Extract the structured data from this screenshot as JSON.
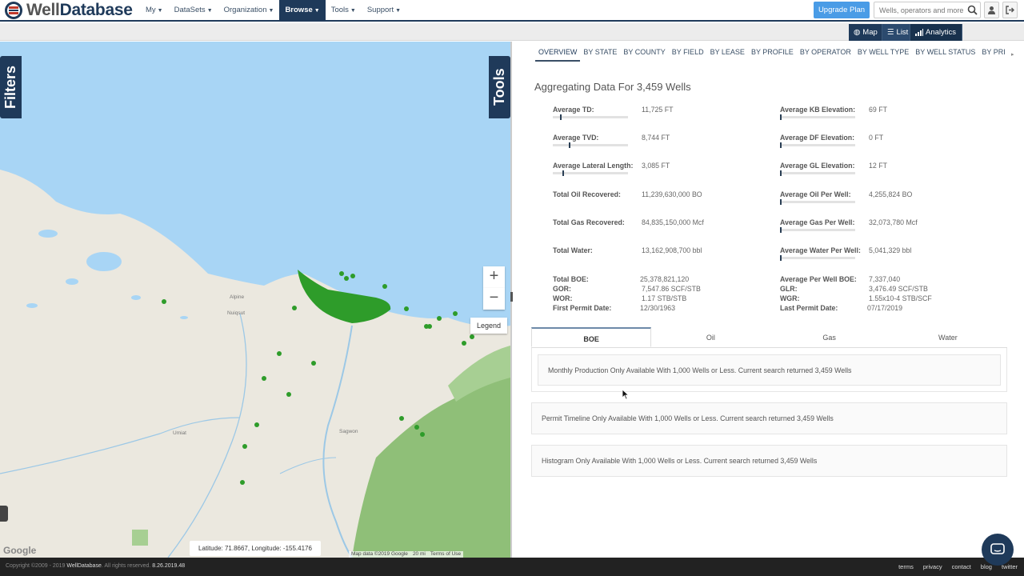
{
  "brand": {
    "logo_text_1": "Well",
    "logo_text_2": "Database"
  },
  "nav": {
    "items": [
      "My",
      "DataSets",
      "Organization",
      "Browse",
      "Tools",
      "Support"
    ],
    "active": "Browse",
    "upgrade_label": "Upgrade Plan",
    "search_placeholder": "Wells, operators and more"
  },
  "view_switch": {
    "map": "Map",
    "list": "List",
    "analytics": "Analytics",
    "active": "Analytics"
  },
  "map": {
    "filters_tab": "Filters",
    "tools_tab": "Tools",
    "zoom_in": "+",
    "zoom_out": "−",
    "legend": "Legend",
    "coordinates": "Latitude: 71.8667, Longitude: -155.4176",
    "google": "Google",
    "attribution": {
      "data": "Map data ©2019 Google",
      "scale": "20 mi",
      "terms": "Terms of Use"
    },
    "places": [
      "Alpine",
      "Nuiqsut",
      "Umiat",
      "Sagwon"
    ],
    "colors": {
      "water": "#a8d5f5",
      "land": "#ebe8df",
      "wells": "#2e9c2a",
      "forest": "#8fbf78"
    }
  },
  "panel": {
    "tabs": [
      "OVERVIEW",
      "BY STATE",
      "BY COUNTY",
      "BY FIELD",
      "BY LEASE",
      "BY PROFILE",
      "BY OPERATOR",
      "BY WELL TYPE",
      "BY WELL STATUS",
      "BY PRIMARY FOR"
    ],
    "active_tab": "OVERVIEW",
    "title": "Aggregating Data For 3,459 Wells",
    "left_stats": [
      {
        "label": "Average TD:",
        "value": "11,725 FT",
        "bar_fraction": 0.1
      },
      {
        "label": "Average TVD:",
        "value": "8,744 FT",
        "bar_fraction": 0.22
      },
      {
        "label": "Average Lateral Length:",
        "value": "3,085 FT",
        "bar_fraction": 0.13
      },
      {
        "label": "Total Oil Recovered:",
        "value": "11,239,630,000 BO"
      },
      {
        "label": "Total Gas Recovered:",
        "value": "84,835,150,000 Mcf"
      },
      {
        "label": "Total Water:",
        "value": "13,162,908,700 bbl"
      }
    ],
    "right_stats": [
      {
        "label": "Average KB Elevation:",
        "value": "69 FT",
        "bar_fraction": 0.0
      },
      {
        "label": "Average DF Elevation:",
        "value": "0 FT",
        "bar_fraction": 0.0
      },
      {
        "label": "Average GL Elevation:",
        "value": "12 FT",
        "bar_fraction": 0.0
      },
      {
        "label": "Average Oil Per Well:",
        "value": "4,255,824 BO",
        "bar_fraction": 0.0
      },
      {
        "label": "Average Gas Per Well:",
        "value": "32,073,780 Mcf",
        "bar_fraction": 0.0
      },
      {
        "label": "Average Water Per Well:",
        "value": "5,041,329 bbl",
        "bar_fraction": 0.0
      }
    ],
    "left_summary": [
      {
        "label": "Total BOE:",
        "value": "25,378,821,120"
      },
      {
        "label": "GOR:",
        "value": "7,547.86 SCF/STB"
      },
      {
        "label": "WOR:",
        "value": "1.17 STB/STB"
      },
      {
        "label": "First Permit Date:",
        "value": "12/30/1963"
      }
    ],
    "right_summary": [
      {
        "label": "Average Per Well BOE:",
        "value": "7,337,040"
      },
      {
        "label": "GLR:",
        "value": "3,476.49 SCF/STB"
      },
      {
        "label": "WGR:",
        "value": "1.55x10-4 STB/SCF"
      },
      {
        "label": "Last Permit Date:",
        "value": "07/17/2019"
      }
    ],
    "chart_tabs": [
      "BOE",
      "Oil",
      "Gas",
      "Water"
    ],
    "active_chart_tab": "BOE",
    "monthly_notice": "Monthly Production Only Available With 1,000 Wells or Less. Current search returned 3,459 Wells",
    "permit_notice": "Permit Timeline Only Available With 1,000 Wells or Less. Current search returned 3,459 Wells",
    "histogram_notice": "Histogram Only Available With 1,000 Wells or Less. Current search returned 3,459 Wells"
  },
  "footer": {
    "copyright": "Copyright ©2009 - 2019",
    "company": "WellDatabase",
    "rights": ". All rights reserved.",
    "version": "8.26.2019.48",
    "links": [
      "terms",
      "privacy",
      "contact",
      "blog",
      "twitter"
    ]
  }
}
